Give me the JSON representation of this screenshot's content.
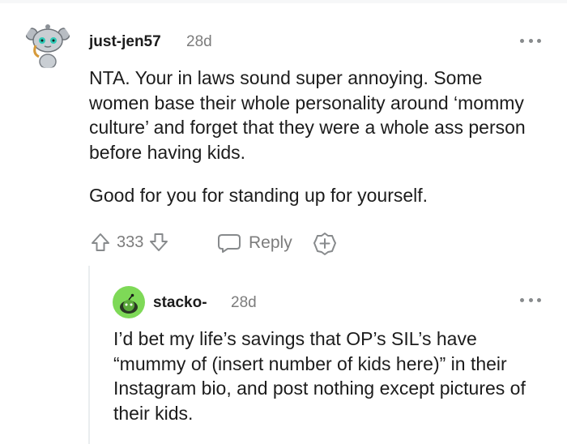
{
  "comments": [
    {
      "username": "just-jen57",
      "time": "28d",
      "paragraphs": [
        "NTA. Your in laws sound super annoying. Some women base their whole personality around ‘mommy culture’ and forget that they were a whole ass person before having kids.",
        "Good for you for standing up for yourself."
      ],
      "score": "333",
      "reply_label": "Reply",
      "avatar_icon": "snoo-avatar-icon"
    },
    {
      "username": "stacko-",
      "time": "28d",
      "paragraphs": [
        "I’d bet my life’s savings that OP’s SIL’s have “mummy of (insert number of kids here)” in their Instagram bio, and post nothing except pictures of their kids."
      ],
      "avatar_icon": "snoo-avatar-icon"
    }
  ],
  "colors": {
    "meta": "#7c7c7c",
    "text": "#1c1c1c",
    "avatar_green": "#7ed957",
    "icon": "#878a8c"
  }
}
